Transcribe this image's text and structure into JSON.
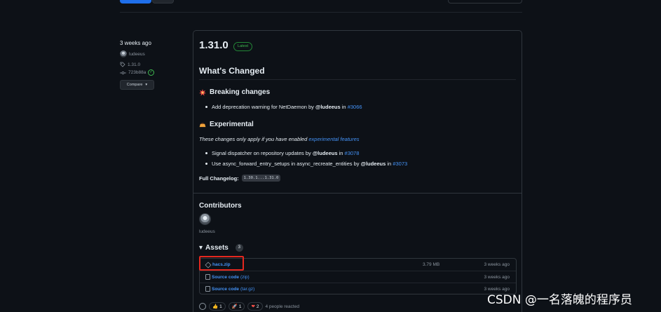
{
  "release": {
    "date": "3 weeks ago",
    "author": "ludeeus",
    "tag": "1.31.0",
    "commit": "723b88a",
    "compare_label": "Compare",
    "title": "1.31.0",
    "latest_label": "Latest"
  },
  "notes": {
    "whats_changed": "What's Changed",
    "breaking": {
      "heading": "Breaking changes",
      "items": [
        {
          "text": "Add deprecation warning for NetDaemon by",
          "user": "@ludeeus",
          "in": "in",
          "pr": "#3066"
        }
      ]
    },
    "experimental": {
      "heading": "Experimental",
      "note_prefix": "These changes only apply if you have enabled",
      "note_link": "experimental features",
      "items": [
        {
          "text": "Signal dispatcher on repository updates by",
          "user": "@ludeeus",
          "in": "in",
          "pr": "#3078"
        },
        {
          "text": "Use async_forward_entry_setups in async_recreate_entities by",
          "user": "@ludeeus",
          "in": "in",
          "pr": "#3073"
        }
      ]
    },
    "changelog_label": "Full Changelog:",
    "changelog_range": "1.30.1...1.31.0"
  },
  "contributors": {
    "title": "Contributors",
    "names": [
      "ludeeus"
    ]
  },
  "assets": {
    "title": "Assets",
    "count": "3",
    "items": [
      {
        "name": "hacs.zip",
        "ext": "",
        "size": "3.79 MB",
        "date": "3 weeks ago"
      },
      {
        "name": "Source code",
        "ext": "(zip)",
        "size": "",
        "date": "3 weeks ago"
      },
      {
        "name": "Source code",
        "ext": "(tar.gz)",
        "size": "",
        "date": "3 weeks ago"
      }
    ]
  },
  "reactions": {
    "thumbs_up": "1",
    "rocket": "1",
    "heart": "2",
    "summary": "4 people reacted"
  },
  "watermark": "CSDN @一名落魄的程序员",
  "colors": {
    "background": "#0d1117",
    "link": "#4493f8",
    "latest_green": "#3fb950",
    "highlight_red": "#e5281f"
  }
}
